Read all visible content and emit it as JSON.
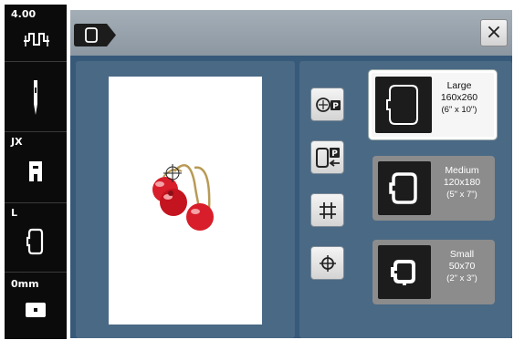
{
  "sidebar": {
    "stitch_width_value": "4.00",
    "presser_foot_label": "JX",
    "hoop_size_label": "L",
    "feed_value": "0mm"
  },
  "header": {
    "close_label": "×"
  },
  "tools": [
    {
      "name": "check-position-button",
      "icon": "hoop-center-p-icon"
    },
    {
      "name": "park-position-button",
      "icon": "hoop-park-icon"
    },
    {
      "name": "grid-button",
      "icon": "grid-icon"
    },
    {
      "name": "center-mark-button",
      "icon": "crosshair-icon"
    }
  ],
  "hoops": [
    {
      "name": "Large",
      "size": "160x260",
      "inches": "(6\" x 10\")",
      "selected": true
    },
    {
      "name": "Medium",
      "size": "120x180",
      "inches": "(5\" x 7\")",
      "selected": false
    },
    {
      "name": "Small",
      "size": "50x70",
      "inches": "(2\" x 3\")",
      "selected": false
    }
  ],
  "colors": {
    "panel_blue": "#37597a",
    "inner_panel": "#4a6985",
    "sidebar_black": "#0b0b0b",
    "cherry_red": "#d81e2a",
    "stem_tan": "#b89a55"
  }
}
